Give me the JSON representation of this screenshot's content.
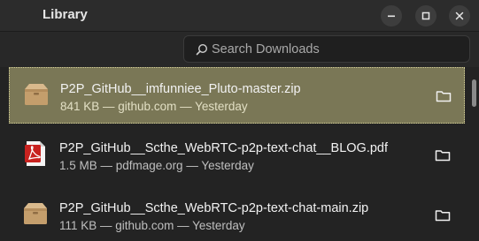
{
  "window": {
    "title": "Library",
    "controls": [
      "minimize-icon",
      "maximize-icon",
      "close-icon"
    ]
  },
  "search": {
    "placeholder": "Search Downloads",
    "value": ""
  },
  "downloads": [
    {
      "name": "P2P_GitHub__imfunniee_Pluto-master.zip",
      "meta": "841 KB — github.com — Yesterday",
      "icon": "archive-icon",
      "selected": true
    },
    {
      "name": "P2P_GitHub__Scthe_WebRTC-p2p-text-chat__BLOG.pdf",
      "meta": "1.5 MB — pdfmage.org — Yesterday",
      "icon": "pdf-icon",
      "selected": false
    },
    {
      "name": "P2P_GitHub__Scthe_WebRTC-p2p-text-chat-main.zip",
      "meta": "111 KB — github.com — Yesterday",
      "icon": "archive-icon",
      "selected": false
    }
  ],
  "colors": {
    "selected_bg": "#7a7756",
    "window_bg": "#282828",
    "list_bg": "#232323"
  }
}
